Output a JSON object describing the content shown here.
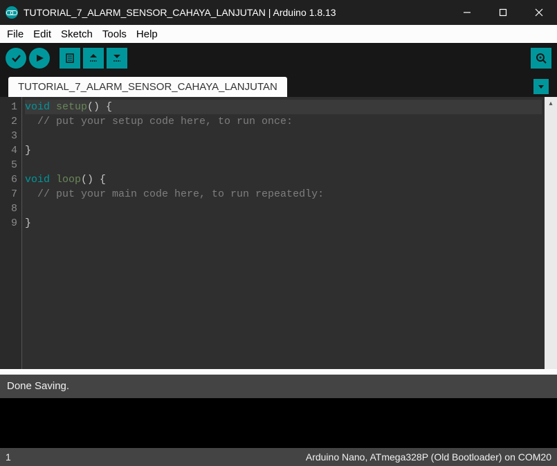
{
  "window": {
    "title": "TUTORIAL_7_ALARM_SENSOR_CAHAYA_LANJUTAN | Arduino 1.8.13"
  },
  "menu": {
    "file": "File",
    "edit": "Edit",
    "sketch": "Sketch",
    "tools": "Tools",
    "help": "Help"
  },
  "tab": {
    "name": "TUTORIAL_7_ALARM_SENSOR_CAHAYA_LANJUTAN"
  },
  "code": {
    "lines": [
      {
        "n": "1",
        "segs": [
          {
            "t": "void ",
            "c": "kw"
          },
          {
            "t": "setup",
            "c": "fn"
          },
          {
            "t": "() {",
            "c": ""
          }
        ],
        "hl": true
      },
      {
        "n": "2",
        "segs": [
          {
            "t": "  // put your setup code here, to run once:",
            "c": "cm"
          }
        ]
      },
      {
        "n": "3",
        "segs": [
          {
            "t": "",
            "c": ""
          }
        ]
      },
      {
        "n": "4",
        "segs": [
          {
            "t": "}",
            "c": ""
          }
        ]
      },
      {
        "n": "5",
        "segs": [
          {
            "t": "",
            "c": ""
          }
        ]
      },
      {
        "n": "6",
        "segs": [
          {
            "t": "void ",
            "c": "kw"
          },
          {
            "t": "loop",
            "c": "fn"
          },
          {
            "t": "() {",
            "c": ""
          }
        ]
      },
      {
        "n": "7",
        "segs": [
          {
            "t": "  // put your main code here, to run repeatedly:",
            "c": "cm"
          }
        ]
      },
      {
        "n": "8",
        "segs": [
          {
            "t": "",
            "c": ""
          }
        ]
      },
      {
        "n": "9",
        "segs": [
          {
            "t": "}",
            "c": ""
          }
        ]
      }
    ]
  },
  "status": {
    "message": "Done Saving."
  },
  "footer": {
    "line": "1",
    "board": "Arduino Nano, ATmega328P (Old Bootloader) on COM20"
  }
}
